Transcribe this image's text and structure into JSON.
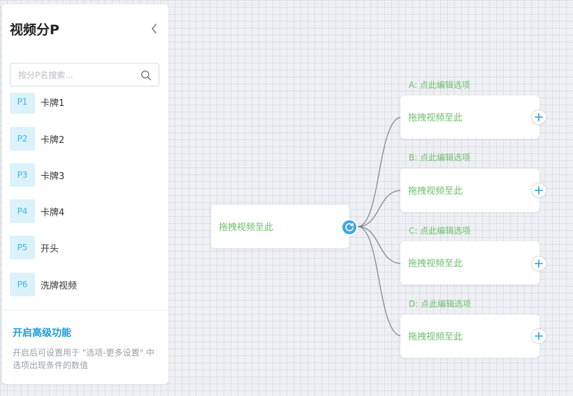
{
  "sidebar": {
    "title": "视频分P",
    "search_placeholder": "按分P名搜索...",
    "items": [
      {
        "badge": "P1",
        "name": "卡牌1"
      },
      {
        "badge": "P2",
        "name": "卡牌2"
      },
      {
        "badge": "P3",
        "name": "卡牌3"
      },
      {
        "badge": "P4",
        "name": "卡牌4"
      },
      {
        "badge": "P5",
        "name": "开头"
      },
      {
        "badge": "P6",
        "name": "洗牌视频"
      }
    ],
    "advanced_title": "开启高级功能",
    "advanced_desc": "开启后可设置用于 \"选项-更多设置\" 中选项出现条件的数值"
  },
  "canvas": {
    "root_node_text": "拖拽视频至此",
    "options": [
      {
        "label": "A: 点此编辑选项",
        "node_text": "拖拽视频至此"
      },
      {
        "label": "B: 点此编辑选项",
        "node_text": "拖拽视频至此"
      },
      {
        "label": "C: 点此编辑选项",
        "node_text": "拖拽视频至此"
      },
      {
        "label": "D: 点此编辑选项",
        "node_text": "拖拽视频至此"
      }
    ]
  },
  "colors": {
    "accent_blue": "#41a6e0",
    "badge_bg": "#dbf2fb",
    "green_text": "#6dbf6d",
    "link_blue": "#1e9ad8"
  },
  "icons": {
    "collapse": "chevron-left-icon",
    "search": "search-icon",
    "switch": "refresh-icon",
    "add": "plus-icon"
  }
}
